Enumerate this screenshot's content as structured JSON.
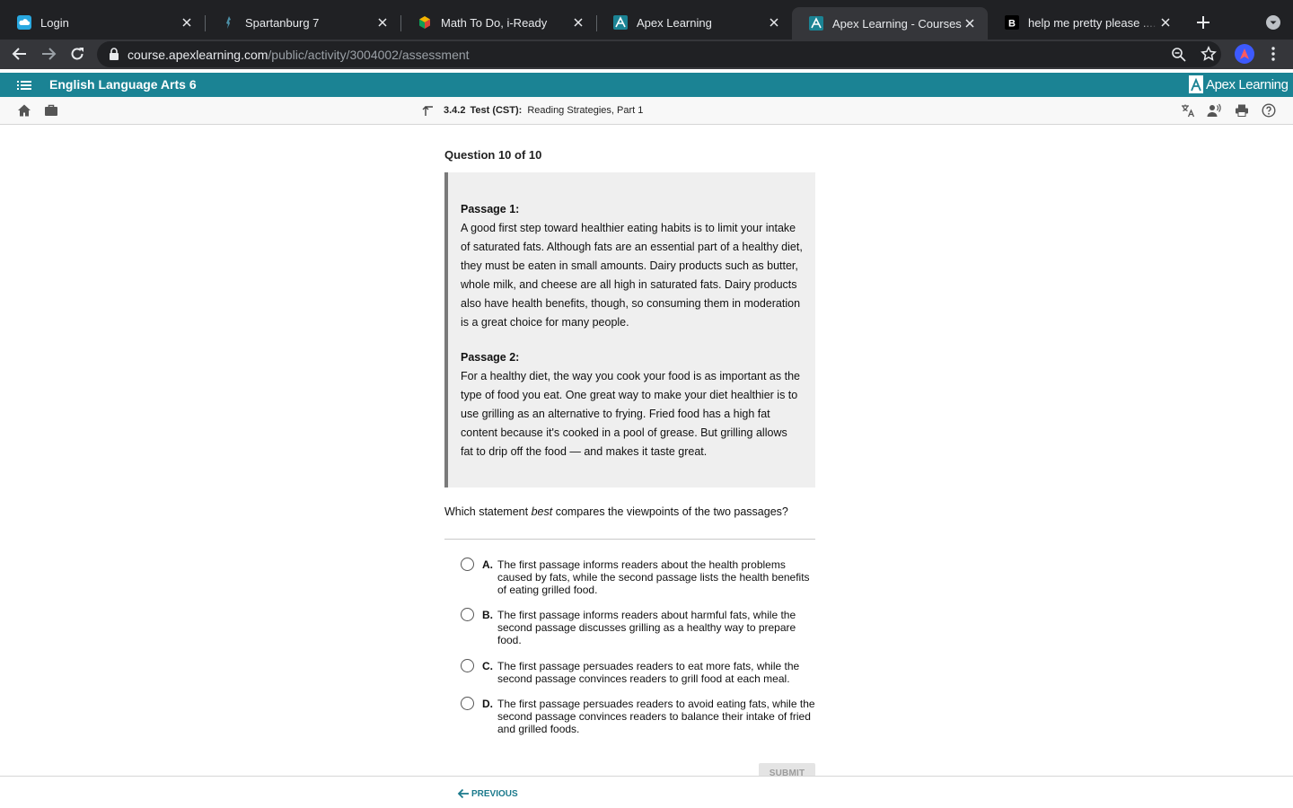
{
  "browser": {
    "tabs": [
      {
        "title": "Login",
        "favicon": "cloud-icon"
      },
      {
        "title": "Spartanburg 7",
        "favicon": "spartan-icon"
      },
      {
        "title": "Math To Do, i-Ready",
        "favicon": "cube-icon"
      },
      {
        "title": "Apex Learning",
        "favicon": "apex-icon"
      },
      {
        "title": "Apex Learning - Courses",
        "favicon": "apex-icon",
        "active": true
      },
      {
        "title": "help me pretty please .... h",
        "favicon": "brainly-icon"
      }
    ],
    "url_host": "course.apexlearning.com",
    "url_path": "/public/activity/3004002/assessment"
  },
  "app": {
    "course_title": "English Language Arts 6",
    "brand": "Apex Learning",
    "accent": "#1b8394"
  },
  "activity": {
    "number": "3.4.2",
    "type": "Test (CST):",
    "name": "Reading Strategies, Part 1"
  },
  "question": {
    "counter": "Question 10 of 10",
    "passages": [
      {
        "title": "Passage 1:",
        "text": "A good first step toward healthier eating habits is to limit your intake of saturated fats. Although fats are an essential part of a healthy diet, they must be eaten in small amounts. Dairy products such as butter, whole milk, and cheese are all high in saturated fats. Dairy products also have health benefits, though, so consuming them in moderation is a great choice for many people."
      },
      {
        "title": "Passage 2:",
        "text": "For a healthy diet, the way you cook your food is as important as the type of food you eat. One great way to make your diet healthier is to use grilling as an alternative to frying. Fried food has a high fat content because it's cooked in a pool of grease. But grilling allows fat to drip off the food — and makes it taste great."
      }
    ],
    "prompt_before": "Which statement ",
    "prompt_emphasis": "best",
    "prompt_after": " compares the viewpoints of the two passages?",
    "choices": [
      {
        "letter": "A.",
        "text": "The first passage informs readers about the health problems caused by fats, while the second passage lists the health benefits of eating grilled food."
      },
      {
        "letter": "B.",
        "text": "The first passage informs readers about harmful fats, while the second passage discusses grilling as a healthy way to prepare food."
      },
      {
        "letter": "C.",
        "text": "The first passage persuades readers to eat more fats, while the second passage convinces readers to grill food at each meal."
      },
      {
        "letter": "D.",
        "text": "The first passage persuades readers to avoid eating fats, while the second passage convinces readers to balance their intake of fried and grilled foods."
      }
    ],
    "submit_label": "SUBMIT"
  },
  "footer": {
    "previous_label": "PREVIOUS"
  }
}
